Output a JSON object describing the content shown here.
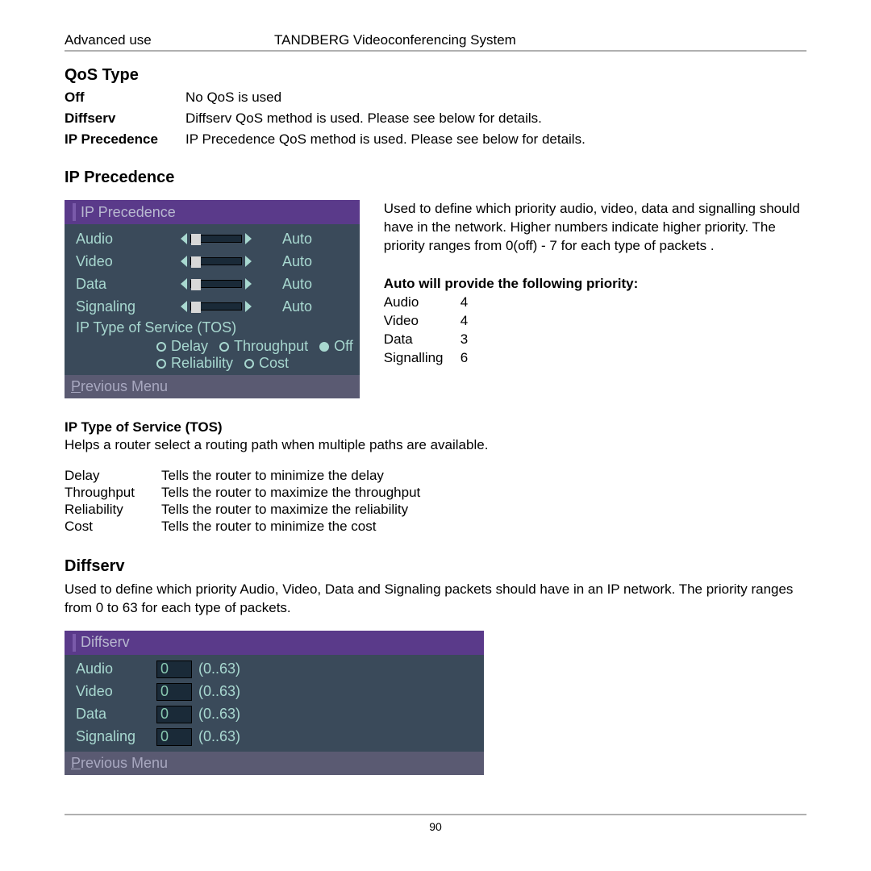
{
  "header": {
    "left": "Advanced use",
    "right": "TANDBERG Videoconferencing System"
  },
  "qos": {
    "title": "QoS Type",
    "rows": [
      {
        "term": "Off",
        "desc": "No QoS is used"
      },
      {
        "term": "Diffserv",
        "desc": "Diffserv QoS method is used. Please see below for details."
      },
      {
        "term": "IP Precedence",
        "desc": "IP Precedence QoS method is used. Please see below for details."
      }
    ]
  },
  "ip": {
    "title": "IP Precedence",
    "panel_title": "IP Precedence",
    "rows": [
      {
        "label": "Audio",
        "value": "Auto"
      },
      {
        "label": "Video",
        "value": "Auto"
      },
      {
        "label": "Data",
        "value": "Auto"
      },
      {
        "label": "Signaling",
        "value": "Auto"
      }
    ],
    "tos_label": "IP Type of Service (TOS)",
    "radios1": {
      "r1": "Delay",
      "r2": "Throughput",
      "r3": "Off"
    },
    "radios2": {
      "r1": "Reliability",
      "r2": "Cost"
    },
    "prev_p": "P",
    "prev_rest": "revious Menu",
    "rtext": "Used to define which priority audio, video, data and signalling should have in the network. Higher numbers indicate higher priority. The priority ranges from 0(off) - 7 for each type of packets .",
    "auto_h": "Auto will provide the following priority:",
    "auto_rows": [
      {
        "label": "Audio",
        "val": "4"
      },
      {
        "label": "Video",
        "val": "4"
      },
      {
        "label": "Data",
        "val": "3"
      },
      {
        "label": "Signalling",
        "val": "6"
      }
    ]
  },
  "tos": {
    "title": "IP Type of Service (TOS)",
    "desc": "Helps a router select a routing path when multiple paths are available.",
    "rows": [
      {
        "term": "Delay",
        "desc": "Tells the router to minimize the delay"
      },
      {
        "term": "Throughput",
        "desc": "Tells the router to maximize the throughput"
      },
      {
        "term": "Reliability",
        "desc": "Tells the router to maximize the reliability"
      },
      {
        "term": "Cost",
        "desc": "Tells the router to minimize the cost"
      }
    ]
  },
  "diff": {
    "title": "Diffserv",
    "desc": "Used to define which priority Audio, Video, Data and Signaling packets should have in an IP network. The priority ranges from 0 to 63 for each type of packets.",
    "panel_title": "Diffserv",
    "rows": [
      {
        "label": "Audio",
        "val": "0",
        "range": "(0..63)"
      },
      {
        "label": "Video",
        "val": "0",
        "range": "(0..63)"
      },
      {
        "label": "Data",
        "val": "0",
        "range": "(0..63)"
      },
      {
        "label": "Signaling",
        "val": "0",
        "range": "(0..63)"
      }
    ],
    "prev_p": "P",
    "prev_rest": "revious Menu"
  },
  "footer": {
    "page": "90"
  }
}
